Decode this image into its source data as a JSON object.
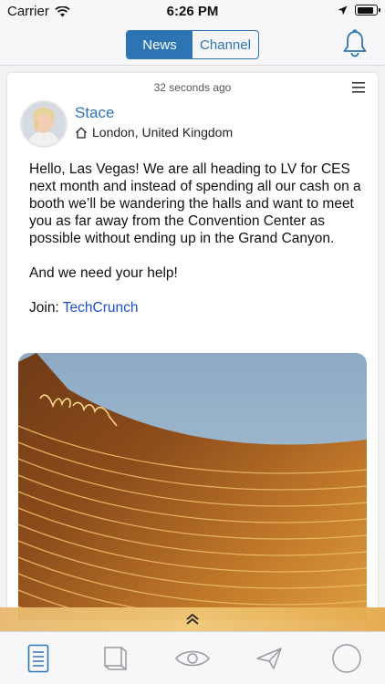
{
  "status_bar": {
    "carrier": "Carrier",
    "time": "6:26 PM",
    "battery_level": 0.92
  },
  "nav": {
    "tabs": [
      {
        "label": "News",
        "active": true
      },
      {
        "label": "Channel",
        "active": false
      }
    ],
    "notification_icon": "bell-icon"
  },
  "post": {
    "timestamp": "32 seconds ago",
    "author": "Stace",
    "location": "London, United Kingdom",
    "paragraphs": [
      "Hello, Las Vegas! We are all heading to LV for CES next month and instead of spending all our cash on a booth we’ll be wandering the halls and want to meet you as far away from the Convention Center as possible without ending up in the Grand Canyon.",
      "And we need your help!"
    ],
    "join_label": "Join:",
    "join_link": "TechCrunch",
    "menu_icon": "hamburger-menu-icon",
    "image_desc_icon": "photo-image"
  },
  "expand_icon": "double-chevron-up-icon",
  "tab_bar": {
    "items": [
      "feed-icon",
      "book-icon",
      "eye-icon",
      "send-icon",
      "circle-icon"
    ]
  },
  "colors": {
    "accent": "#2d74b5",
    "link": "#1d4fd6"
  }
}
